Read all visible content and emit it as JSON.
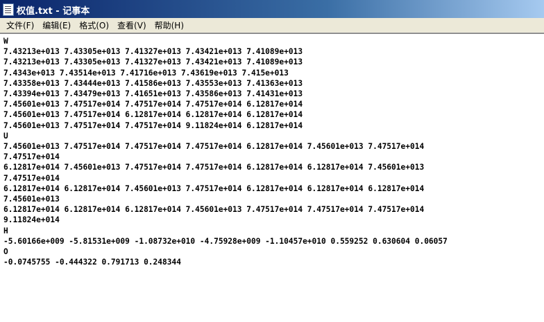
{
  "window": {
    "title": "权值.txt - 记事本",
    "icon": "notepad-icon"
  },
  "menu": [
    {
      "label": "文件(F)"
    },
    {
      "label": "编辑(E)"
    },
    {
      "label": "格式(O)"
    },
    {
      "label": "查看(V)"
    },
    {
      "label": "帮助(H)"
    }
  ],
  "content": {
    "lines": [
      "W",
      "7.43213e+013 7.43305e+013 7.41327e+013 7.43421e+013 7.41089e+013",
      "7.43213e+013 7.43305e+013 7.41327e+013 7.43421e+013 7.41089e+013",
      "7.4343e+013 7.43514e+013 7.41716e+013 7.43619e+013 7.415e+013",
      "7.43358e+013 7.43444e+013 7.41586e+013 7.43553e+013 7.41363e+013",
      "7.43394e+013 7.43479e+013 7.41651e+013 7.43586e+013 7.41431e+013",
      "7.45601e+013 7.47517e+014 7.47517e+014 7.47517e+014 6.12817e+014",
      "7.45601e+013 7.47517e+014 6.12817e+014 6.12817e+014 6.12817e+014",
      "7.45601e+013 7.47517e+014 7.47517e+014 9.11824e+014 6.12817e+014",
      "U",
      "7.45601e+013 7.47517e+014 7.47517e+014 7.47517e+014 6.12817e+014 7.45601e+013 7.47517e+014",
      "7.47517e+014",
      "6.12817e+014 7.45601e+013 7.47517e+014 7.47517e+014 6.12817e+014 6.12817e+014 7.45601e+013",
      "7.47517e+014",
      "6.12817e+014 6.12817e+014 7.45601e+013 7.47517e+014 6.12817e+014 6.12817e+014 6.12817e+014",
      "7.45601e+013",
      "6.12817e+014 6.12817e+014 6.12817e+014 7.45601e+013 7.47517e+014 7.47517e+014 7.47517e+014",
      "9.11824e+014",
      "H",
      "-5.60166e+009 -5.81531e+009 -1.08732e+010 -4.75928e+009 -1.10457e+010 0.559252 0.630604 0.06057",
      "O",
      "-0.0745755 -0.444322 0.791713 0.248344"
    ]
  }
}
